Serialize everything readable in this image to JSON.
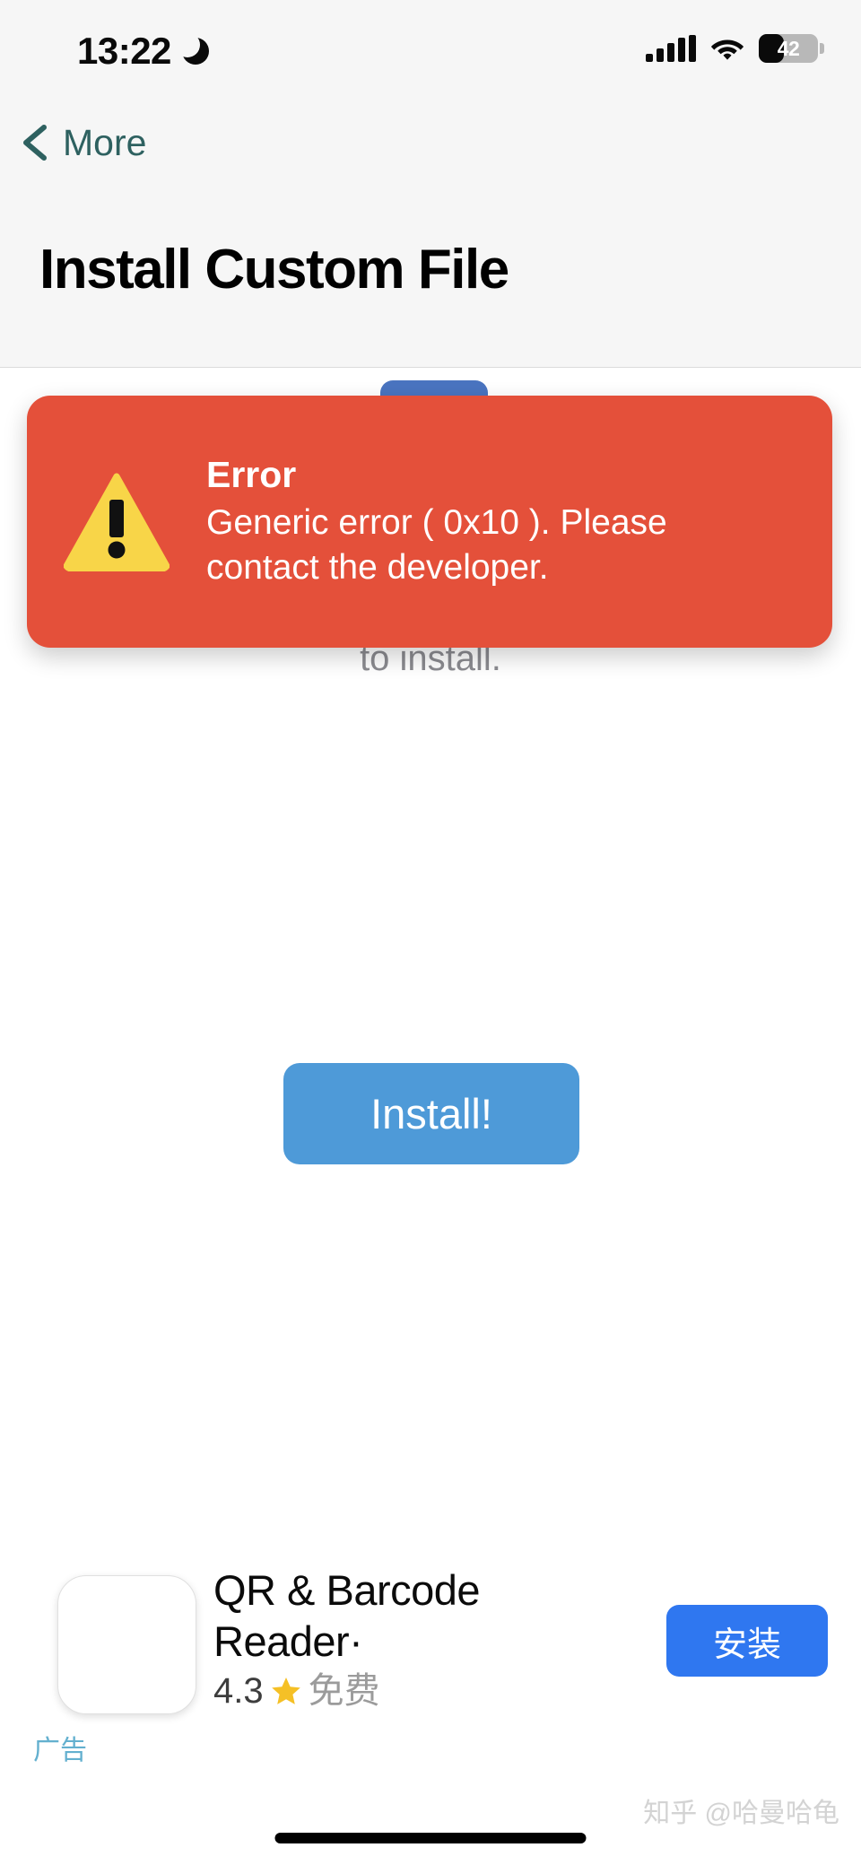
{
  "status_bar": {
    "time": "13:22",
    "dnd_icon": "crescent-moon-icon",
    "signal_icon": "cellular-signal-icon",
    "wifi_icon": "wifi-icon",
    "battery_level": "42",
    "battery_percent": 42
  },
  "nav": {
    "back_label": "More",
    "back_icon": "chevron-left-icon"
  },
  "header": {
    "title": "Install Custom File"
  },
  "toast": {
    "icon": "warning-triangle-icon",
    "title": "Error",
    "message": "Generic error ( 0x10 ). Please contact the developer.",
    "background_color": "#e4503a",
    "icon_color": "#f8d548",
    "text_color": "#ffffff"
  },
  "main": {
    "install_label": "Install!",
    "install_color": "#4e9ad8",
    "obscured_hint_text": "to install.",
    "obscured_button_color": "#4a74c0"
  },
  "ad": {
    "title": "QR & Barcode Reader·",
    "rating": "4.3",
    "star_icon": "star-icon",
    "price": "免费",
    "install_label": "安装",
    "install_color": "#2f77f0",
    "ad_label": "广告",
    "ad_label_color": "#63b0cf",
    "app_icon": "app-icon-placeholder"
  },
  "watermark": {
    "text": "知乎 @哈曼哈龟"
  }
}
